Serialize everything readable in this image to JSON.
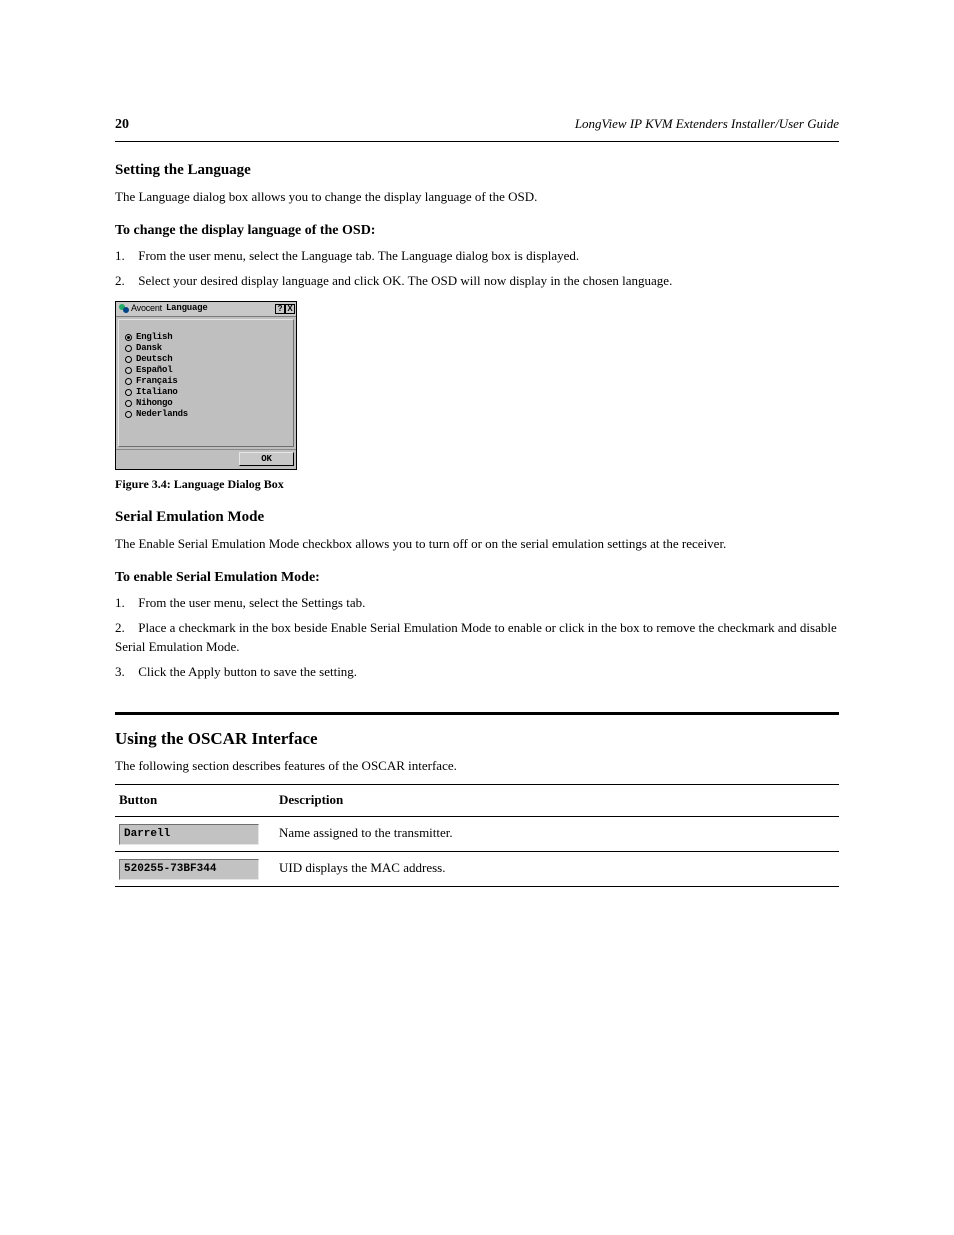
{
  "header": {
    "page_number": "20",
    "running_title": "LongView IP KVM Extenders Installer/User Guide"
  },
  "sec_lang_heading": "Setting the Language",
  "sec_lang_desc": "The Language dialog box allows you to change the display language of the OSD.",
  "proc_lang_heading": "To change the display language of the OSD:",
  "proc_lang_steps": [
    {
      "n": "1.",
      "text": "From the user menu, select the Language tab. The Language dialog box is displayed."
    },
    {
      "n": "2.",
      "text": "Select your desired display language and click OK. The OSD will now display in the chosen language."
    }
  ],
  "dialog": {
    "brand": "Avocent",
    "title": "Language",
    "help_label": "?",
    "close_label": "X",
    "languages": [
      {
        "label": "English",
        "selected": true
      },
      {
        "label": "Dansk",
        "selected": false
      },
      {
        "label": "Deutsch",
        "selected": false
      },
      {
        "label": "Español",
        "selected": false
      },
      {
        "label": "Français",
        "selected": false
      },
      {
        "label": "Italiano",
        "selected": false
      },
      {
        "label": "Nihongo",
        "selected": false
      },
      {
        "label": "Nederlands",
        "selected": false
      }
    ],
    "ok": "OK"
  },
  "figure_caption": "Figure 3.4: Language Dialog Box",
  "sec_serial_heading": "Serial Emulation Mode",
  "sec_serial_desc": "The Enable Serial Emulation Mode checkbox allows you to turn off or on the serial emulation settings at the receiver.",
  "proc_serial_heading": "To enable Serial Emulation Mode:",
  "proc_serial_steps": [
    {
      "n": "1.",
      "text": "From the user menu, select the Settings tab."
    },
    {
      "n": "2.",
      "text": "Place a checkmark in the box beside Enable Serial Emulation Mode to enable or click in the box to remove the checkmark and disable Serial Emulation Mode."
    },
    {
      "n": "3.",
      "text": "Click the Apply button to save the setting."
    }
  ],
  "oscar_title": "Using the OSCAR Interface",
  "oscar_desc": "The following section describes features of the OSCAR interface.",
  "table": {
    "col_button": "Button",
    "col_desc": "Description",
    "row_name": {
      "value": "Darrell",
      "desc": "Name assigned to the transmitter."
    },
    "row_uid": {
      "value": "520255-73BF344",
      "desc": "UID displays the MAC address."
    }
  }
}
